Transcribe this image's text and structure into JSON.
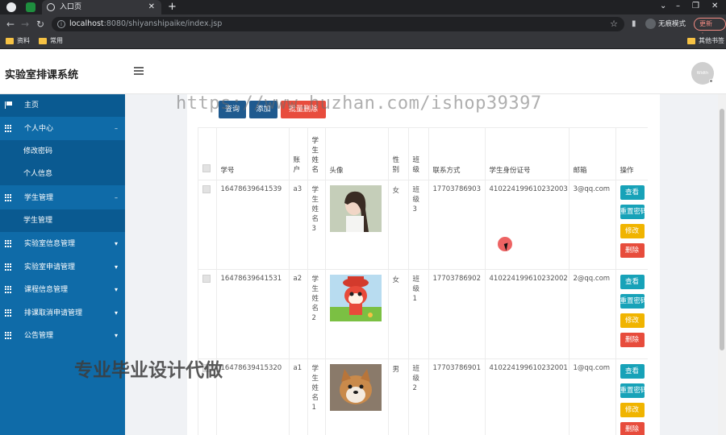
{
  "browser": {
    "tab_title": "入口页",
    "url_host": "localhost",
    "url_path": ":8080/shiyanshipaike/index.jsp",
    "incognito_label": "无痕模式",
    "update_label": "更新",
    "bookmarks": [
      "资料",
      "常用"
    ],
    "other_bookmarks": "其他书签"
  },
  "app": {
    "title": "实验室排课系统",
    "avatar_text": "Width"
  },
  "sidebar": {
    "home": "主页",
    "personal_center": "个人中心",
    "change_password": "修改密码",
    "personal_info": "个人信息",
    "student_mgmt": "学生管理",
    "student_mgmt_sub": "学生管理",
    "lab_info_mgmt": "实验室信息管理",
    "lab_apply_mgmt": "实验室申请管理",
    "course_info_mgmt": "课程信息管理",
    "schedule_cancel_mgmt": "排课取消申请管理",
    "notice_mgmt": "公告管理"
  },
  "toolbar": {
    "search": "查询",
    "add": "添加",
    "batch_delete": "批量删除"
  },
  "table": {
    "headers": [
      "学号",
      "账户",
      "学生姓名",
      "头像",
      "性别",
      "班级",
      "联系方式",
      "学生身份证号",
      "邮箱",
      "操作"
    ],
    "rows": [
      {
        "id": "16478639641539",
        "account": "a3",
        "name": "学生姓名3",
        "gender": "女",
        "class": "班级3",
        "phone": "17703786903",
        "idcard": "410224199610232003",
        "email": "3@qq.com"
      },
      {
        "id": "16478639641531",
        "account": "a2",
        "name": "学生姓名2",
        "gender": "女",
        "class": "班级1",
        "phone": "17703786902",
        "idcard": "410224199610232002",
        "email": "2@qq.com"
      },
      {
        "id": "16478639415320",
        "account": "a1",
        "name": "学生姓名1",
        "gender": "男",
        "class": "班级2",
        "phone": "17703786901",
        "idcard": "410224199610232001",
        "email": "1@qq.com"
      }
    ],
    "actions": {
      "view": "查看",
      "reset": "重置密码",
      "edit": "修改",
      "delete": "删除"
    }
  },
  "watermarks": {
    "url": "https://www.huzhan.com/ishop39397",
    "text": "专业毕业设计代做"
  },
  "colors": {
    "sidebar": "#0f6ba8",
    "primary_button": "#1f5a8f",
    "danger": "#e74c3c",
    "info": "#17a2b8",
    "warning": "#f0b400"
  }
}
